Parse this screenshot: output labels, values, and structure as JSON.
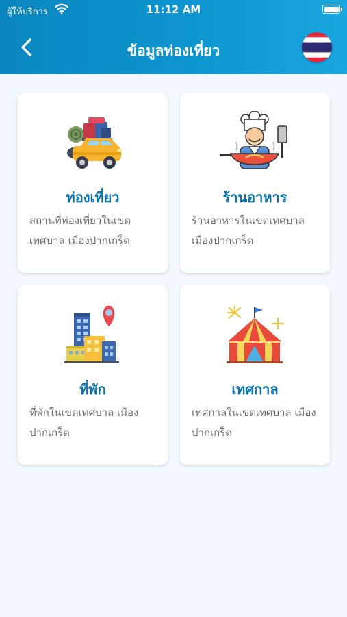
{
  "status_bar": {
    "carrier": "ผู้ให้บริการ",
    "time": "11:12 AM"
  },
  "header": {
    "title": "ข้อมูลท่องเที่ยว"
  },
  "cards": [
    {
      "title": "ท่องเที่ยว",
      "description": "สถานที่ท่องเที่ยวในเขต เทศบาล เมืองปากเกร็ด",
      "icon": "car-luggage-icon"
    },
    {
      "title": "ร้านอาหาร",
      "description": "ร้านอาหารในเขตเทศบาล เมืองปากเกร็ด",
      "icon": "chef-cooking-icon"
    },
    {
      "title": "ที่พัก",
      "description": "ที่พักในเขตเทศบาล เมือง ปากเกร็ด",
      "icon": "hotel-location-icon"
    },
    {
      "title": "เทศกาล",
      "description": "เทศกาลในเขตเทศบาล เมือง ปากเกร็ด",
      "icon": "festival-tent-icon"
    }
  ],
  "colors": {
    "header": "#0d95cf",
    "card_title": "#0a72aa",
    "background": "#f2f8fd"
  }
}
